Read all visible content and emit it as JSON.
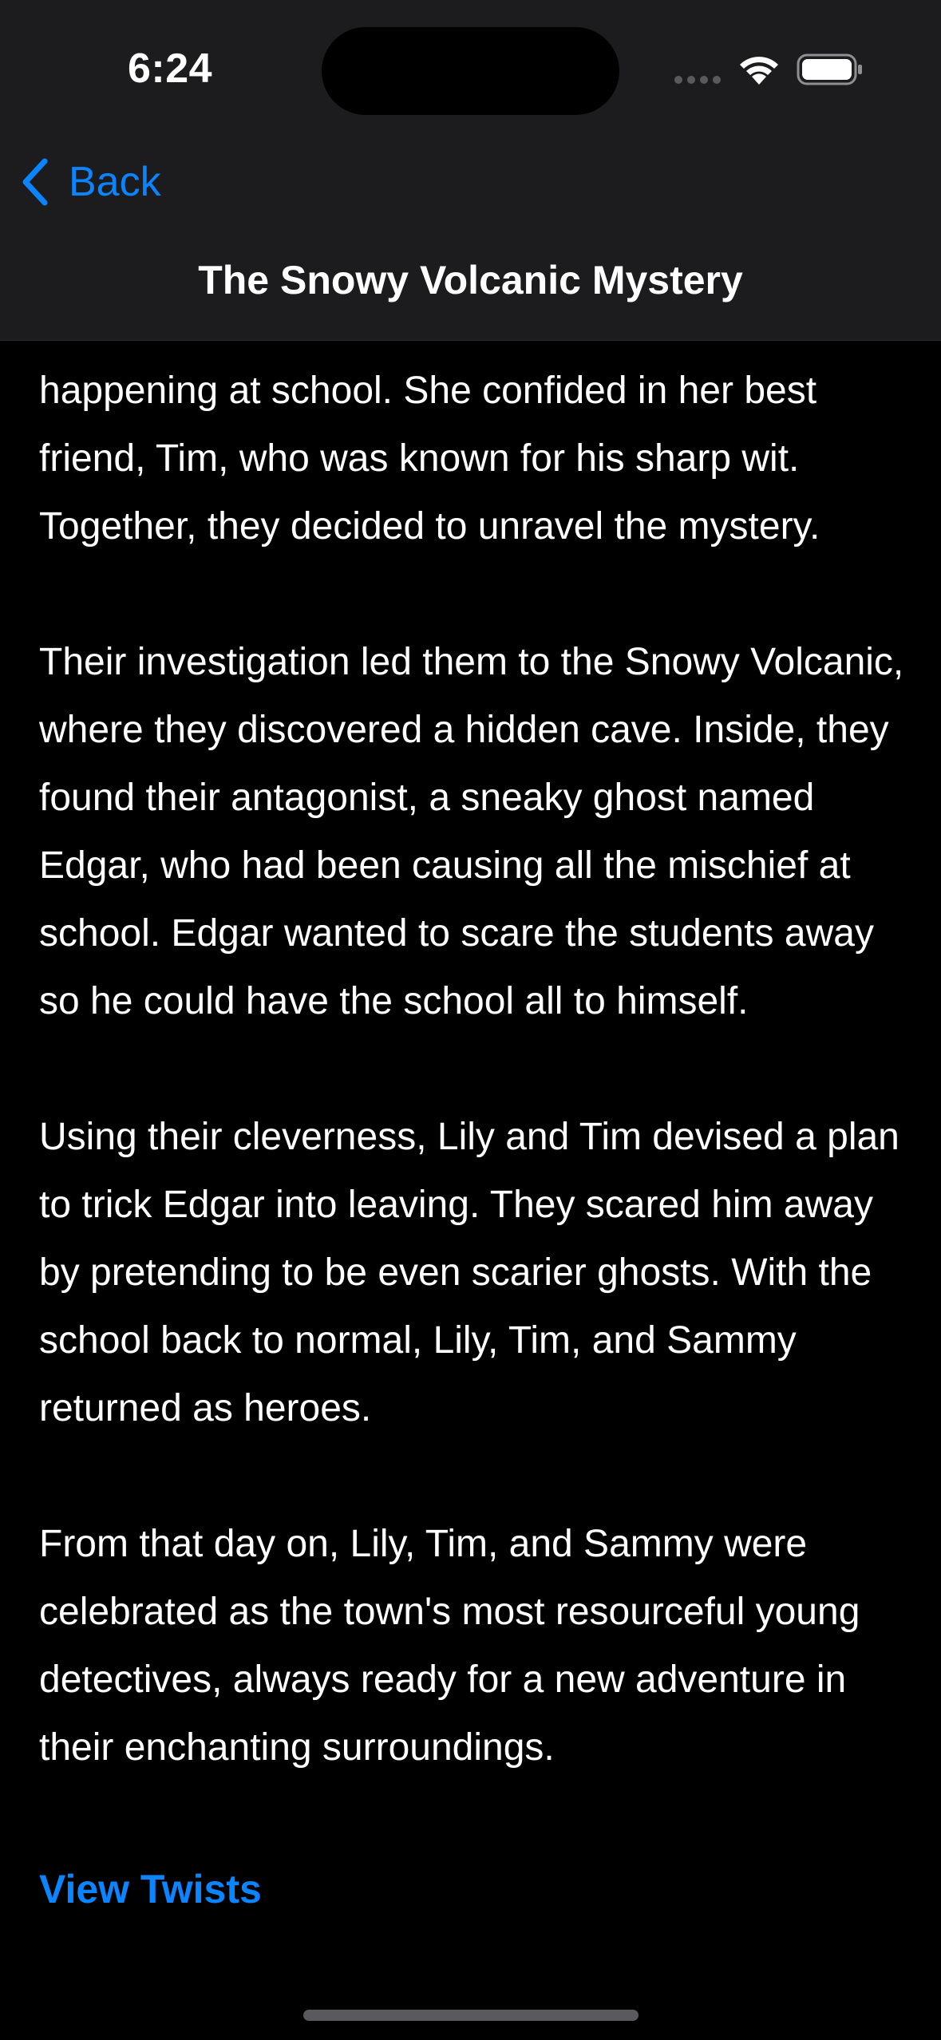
{
  "status_bar": {
    "time": "6:24",
    "icons": [
      "cellular-signal-icon",
      "wifi-icon",
      "battery-icon"
    ]
  },
  "nav": {
    "back_label": "Back",
    "back_icon": "chevron-left-icon",
    "title": "The Snowy Volcanic Mystery"
  },
  "story": {
    "paragraphs": [
      "happening at school. She confided in her best friend, Tim, who was known for his sharp wit. Together, they decided to unravel the mystery.",
      "Their investigation led them to the Snowy Volcanic, where they discovered a hidden cave. Inside, they found their antagonist, a sneaky ghost named Edgar, who had been causing all the mischief at school. Edgar wanted to scare the students away so he could have the school all to himself.",
      "Using their cleverness, Lily and Tim devised a plan to trick Edgar into leaving. They scared him away by pretending to be even scarier ghosts. With the school back to normal, Lily, Tim, and Sammy returned as heroes.",
      "From that day on, Lily, Tim, and Sammy were celebrated as the town's most resourceful young detectives, always ready for a new adventure in their enchanting surroundings."
    ]
  },
  "actions": {
    "view_twists_label": "View Twists"
  },
  "colors": {
    "background": "#000000",
    "nav_background": "#1c1c1e",
    "accent": "#0a84ff",
    "text": "#ffffff"
  }
}
